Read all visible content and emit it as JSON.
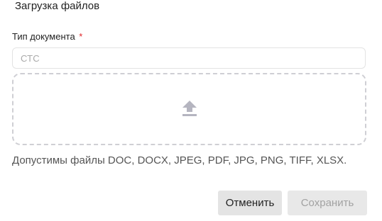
{
  "dialog": {
    "title": "Загрузка файлов"
  },
  "doc_type_field": {
    "label": "Тип документа",
    "required_marker": "*",
    "value": "СТС"
  },
  "dropzone": {
    "icon": "upload-icon",
    "allowed_formats_text": "Допустимы файлы DOC, DOCX, JPEG, PDF, JPG, PNG, TIFF, XLSX."
  },
  "actions": {
    "cancel_label": "Отменить",
    "save_label": "Сохранить",
    "save_enabled": false
  },
  "colors": {
    "required": "#e0262b",
    "icon": "#b5b5c0",
    "button_bg": "#e4e4e4",
    "disabled_text": "#a2a2a2"
  }
}
